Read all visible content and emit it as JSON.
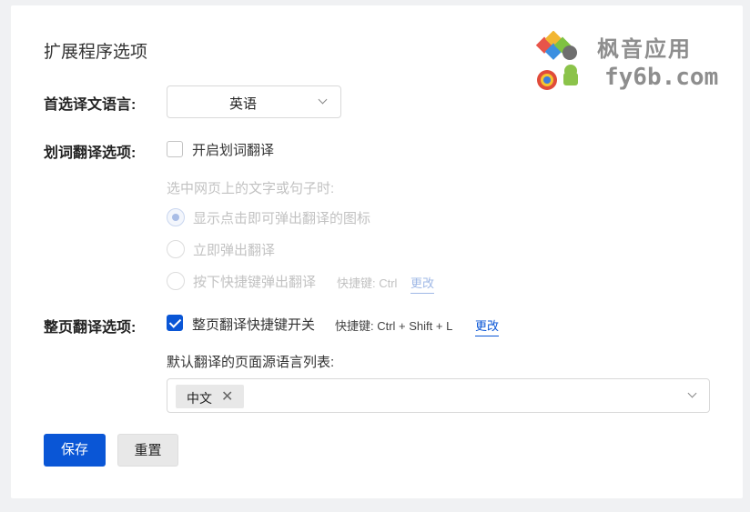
{
  "page": {
    "title": "扩展程序选项"
  },
  "preferred_language": {
    "label": "首选译文语言:",
    "value": "英语"
  },
  "word_translation": {
    "label": "划词翻译选项:",
    "enable_label": "开启划词翻译",
    "enabled": false,
    "subheading": "选中网页上的文字或句子时:",
    "options": [
      {
        "label": "显示点击即可弹出翻译的图标",
        "selected": true
      },
      {
        "label": "立即弹出翻译",
        "selected": false
      },
      {
        "label": "按下快捷键弹出翻译",
        "selected": false
      }
    ],
    "shortcut_hint": "快捷键: Ctrl",
    "change_link": "更改"
  },
  "page_translation": {
    "label": "整页翻译选项:",
    "shortcut_toggle_label": "整页翻译快捷键开关",
    "shortcut_enabled": true,
    "shortcut_hint": "快捷键: Ctrl + Shift + L",
    "change_link": "更改",
    "source_list_label": "默认翻译的页面源语言列表:",
    "source_languages": [
      "中文"
    ],
    "remove_tag_glyph": "✕"
  },
  "actions": {
    "save_label": "保存",
    "reset_label": "重置"
  },
  "watermark": {
    "name": "枫音应用",
    "domain": "fy6b.com"
  },
  "colors": {
    "primary": "#0a56d6",
    "muted_text": "#c2c2c2",
    "background": "#f0f1f3"
  }
}
